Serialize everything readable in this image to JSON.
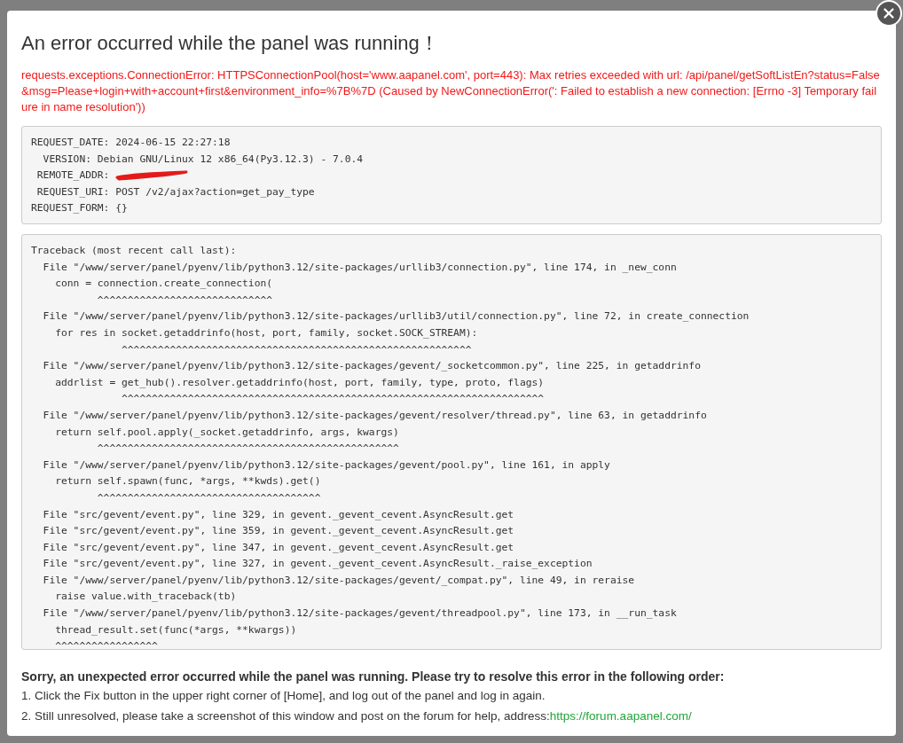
{
  "dialog": {
    "title": "An error occurred while the panel was running！",
    "error_message": "requests.exceptions.ConnectionError: HTTPSConnectionPool(host='www.aapanel.com', port=443): Max retries exceeded with url: /api/panel/getSoftListEn?status=False&msg=Please+login+with+account+first&environment_info=%7B%7D (Caused by NewConnectionError(': Failed to establish a new connection: [Errno -3] Temporary failure in name resolution'))",
    "request_info": [
      {
        "kind": "line",
        "text": "REQUEST_DATE: 2024-06-15 22:27:18"
      },
      {
        "kind": "line",
        "text": "  VERSION: Debian GNU/Linux 12 x86_64(Py3.12.3) - 7.0.4"
      },
      {
        "kind": "redacted",
        "text": " REMOTE_ADDR: "
      },
      {
        "kind": "line",
        "text": " REQUEST_URI: POST /v2/ajax?action=get_pay_type"
      },
      {
        "kind": "line",
        "text": "REQUEST_FORM: {}"
      }
    ],
    "traceback": [
      "Traceback (most recent call last):",
      "  File \"/www/server/panel/pyenv/lib/python3.12/site-packages/urllib3/connection.py\", line 174, in _new_conn",
      "    conn = connection.create_connection(",
      "           ^^^^^^^^^^^^^^^^^^^^^^^^^^^^^",
      "  File \"/www/server/panel/pyenv/lib/python3.12/site-packages/urllib3/util/connection.py\", line 72, in create_connection",
      "    for res in socket.getaddrinfo(host, port, family, socket.SOCK_STREAM):",
      "               ^^^^^^^^^^^^^^^^^^^^^^^^^^^^^^^^^^^^^^^^^^^^^^^^^^^^^^^^^^",
      "  File \"/www/server/panel/pyenv/lib/python3.12/site-packages/gevent/_socketcommon.py\", line 225, in getaddrinfo",
      "    addrlist = get_hub().resolver.getaddrinfo(host, port, family, type, proto, flags)",
      "               ^^^^^^^^^^^^^^^^^^^^^^^^^^^^^^^^^^^^^^^^^^^^^^^^^^^^^^^^^^^^^^^^^^^^^^",
      "  File \"/www/server/panel/pyenv/lib/python3.12/site-packages/gevent/resolver/thread.py\", line 63, in getaddrinfo",
      "    return self.pool.apply(_socket.getaddrinfo, args, kwargs)",
      "           ^^^^^^^^^^^^^^^^^^^^^^^^^^^^^^^^^^^^^^^^^^^^^^^^^^",
      "  File \"/www/server/panel/pyenv/lib/python3.12/site-packages/gevent/pool.py\", line 161, in apply",
      "    return self.spawn(func, *args, **kwds).get()",
      "           ^^^^^^^^^^^^^^^^^^^^^^^^^^^^^^^^^^^^^",
      "  File \"src/gevent/event.py\", line 329, in gevent._gevent_cevent.AsyncResult.get",
      "  File \"src/gevent/event.py\", line 359, in gevent._gevent_cevent.AsyncResult.get",
      "  File \"src/gevent/event.py\", line 347, in gevent._gevent_cevent.AsyncResult.get",
      "  File \"src/gevent/event.py\", line 327, in gevent._gevent_cevent.AsyncResult._raise_exception",
      "  File \"/www/server/panel/pyenv/lib/python3.12/site-packages/gevent/_compat.py\", line 49, in reraise",
      "    raise value.with_traceback(tb)",
      "  File \"/www/server/panel/pyenv/lib/python3.12/site-packages/gevent/threadpool.py\", line 173, in __run_task",
      "    thread_result.set(func(*args, **kwargs))",
      "    ^^^^^^^^^^^^^^^^^"
    ],
    "help_heading": "Sorry, an unexpected error occurred while the panel was running. Please try to resolve this error in the following order:",
    "help_steps": [
      {
        "text": "1. Click the Fix button in the upper right corner of [Home], and log out of the panel and log in again."
      },
      {
        "text": "2. Still unresolved, please take a screenshot of this window and post on the forum for help, address:",
        "link": "https://forum.aapanel.com/"
      }
    ]
  }
}
